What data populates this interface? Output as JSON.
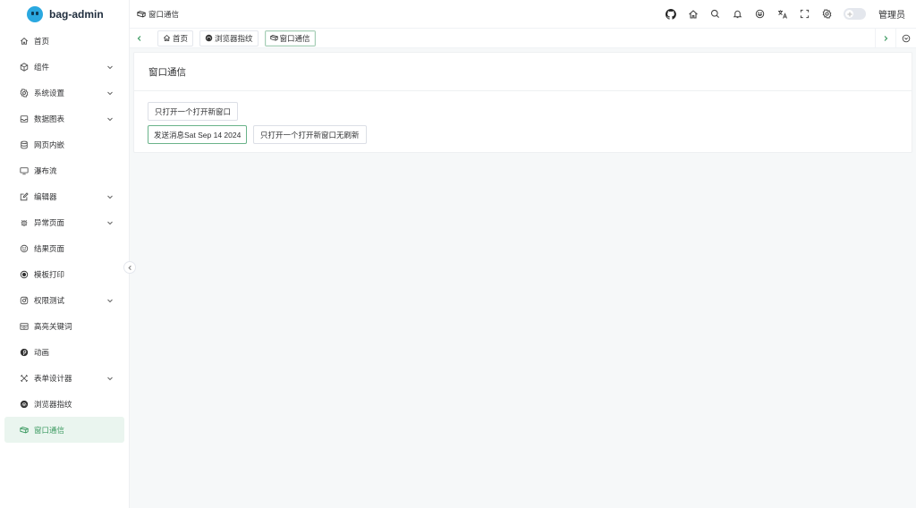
{
  "app": {
    "name": "bag-admin"
  },
  "sidebar": {
    "items": [
      {
        "label": "首页",
        "icon": "home-icon",
        "has_children": false
      },
      {
        "label": "组件",
        "icon": "cube-icon",
        "has_children": true
      },
      {
        "label": "系统设置",
        "icon": "gear-icon",
        "has_children": true
      },
      {
        "label": "数据图表",
        "icon": "inbox-icon",
        "has_children": true
      },
      {
        "label": "网页内嵌",
        "icon": "database-icon",
        "has_children": false
      },
      {
        "label": "瀑布流",
        "icon": "monitor-icon",
        "has_children": false
      },
      {
        "label": "编辑器",
        "icon": "edit-icon",
        "has_children": true
      },
      {
        "label": "异常页面",
        "icon": "bug-icon",
        "has_children": true
      },
      {
        "label": "结果页面",
        "icon": "smile-icon",
        "has_children": false
      },
      {
        "label": "模板打印",
        "icon": "record-icon",
        "has_children": false
      },
      {
        "label": "权限测试",
        "icon": "instagram-icon",
        "has_children": true
      },
      {
        "label": "高亮关键词",
        "icon": "table-icon",
        "has_children": false
      },
      {
        "label": "动画",
        "icon": "pinterest-icon",
        "has_children": false
      },
      {
        "label": "表单设计器",
        "icon": "tools-icon",
        "has_children": true
      },
      {
        "label": "浏览器指纹",
        "icon": "fingerprint-icon",
        "has_children": false
      },
      {
        "label": "窗口通信",
        "icon": "window-icon",
        "has_children": false,
        "active": true
      }
    ]
  },
  "header": {
    "breadcrumb": "窗口通信",
    "user": "管理员",
    "actions": [
      "github-icon",
      "home-icon",
      "search-icon",
      "bell-icon",
      "emoji-icon",
      "translate-icon",
      "fullscreen-icon",
      "settings-icon"
    ]
  },
  "tabs": [
    {
      "label": "首页",
      "icon": "home-icon"
    },
    {
      "label": "浏览器指纹",
      "icon": "fingerprint-icon"
    },
    {
      "label": "窗口通信",
      "icon": "window-icon",
      "active": true
    }
  ],
  "main": {
    "title": "窗口通信",
    "open_single_button": "只打开一个打开新窗口",
    "message_input_value": "发送消息Sat Sep 14 2024",
    "open_no_refresh_button": "只打开一个打开新窗口无刷新"
  },
  "colors": {
    "accent": "#3d9b62",
    "active_bg": "#eaf5ef",
    "brand_logo": "#2aa8e0"
  }
}
